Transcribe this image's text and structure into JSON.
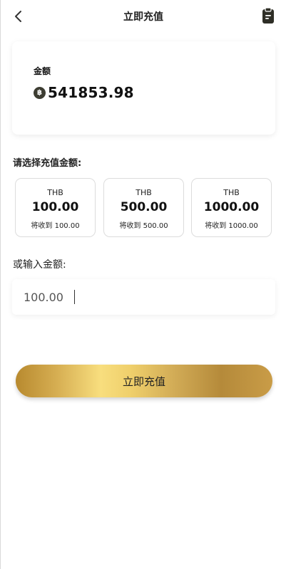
{
  "header": {
    "title": "立即充值"
  },
  "balance": {
    "label": "金额",
    "currency_symbol": "฿",
    "value": "541853.98"
  },
  "options_section": {
    "title": "请选择充值金额:"
  },
  "options": [
    {
      "currency": "THB",
      "amount": "100.00",
      "receive": "将收到 100.00"
    },
    {
      "currency": "THB",
      "amount": "500.00",
      "receive": "将收到 500.00"
    },
    {
      "currency": "THB",
      "amount": "1000.00",
      "receive": "将收到 1000.00"
    }
  ],
  "custom_amount": {
    "label": "或输入金额:",
    "value": "100.00"
  },
  "submit": {
    "label": "立即充值"
  },
  "colors": {
    "gold_light": "#f8de7e",
    "gold_dark": "#b88a2f",
    "icon_dark": "#3d3d32"
  }
}
